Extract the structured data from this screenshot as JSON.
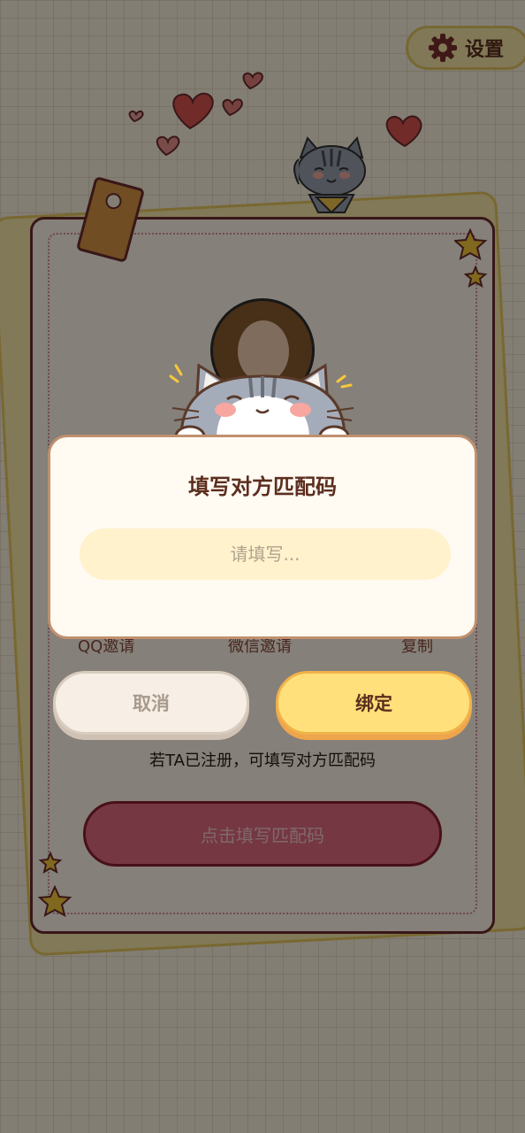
{
  "header": {
    "settings_label": "设置",
    "settings_icon": "gear-icon"
  },
  "card": {
    "invite_qq": "QQ邀请",
    "invite_wechat": "微信邀请",
    "copy": "复制",
    "bind_hint": "若TA已注册，可填写对方匹配码",
    "fill_code_button": "点击填写匹配码"
  },
  "dialog": {
    "title": "填写对方匹配码",
    "input_value": "",
    "input_placeholder": "请填写...",
    "cancel_label": "取消",
    "confirm_label": "绑定"
  },
  "colors": {
    "accent": "#ffe07a",
    "dialog_bg": "#fffaf2",
    "card_border": "#6b2d2d",
    "pink_button": "#e06a7f"
  }
}
